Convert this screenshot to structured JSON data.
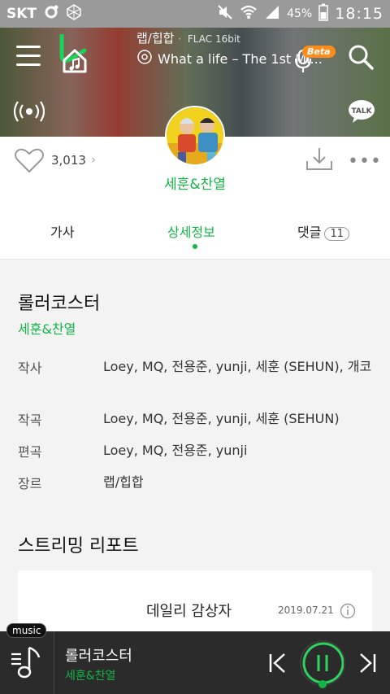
{
  "status": {
    "carrier": "SKT",
    "battery": "45%",
    "time": "18:15"
  },
  "header": {
    "genre": "랩/힙합",
    "quality": "FLAC 16bit",
    "now_playing": "What a life – The 1st Mi...",
    "beta_badge": "Beta",
    "talk_label": "TALK"
  },
  "song": {
    "artist": "세훈&찬열",
    "likes": "3,013",
    "title": "롤러코스터"
  },
  "tabs": [
    {
      "label": "가사",
      "active": false
    },
    {
      "label": "상세정보",
      "active": true
    },
    {
      "label": "댓글",
      "count": "11",
      "active": false
    }
  ],
  "details": [
    {
      "label": "작사",
      "value": "Loey, MQ, 전용준, yunji, 세훈 (SEHUN), 개코"
    },
    {
      "label": "작곡",
      "value": "Loey, MQ, 전용준, yunji, 세훈 (SEHUN)"
    },
    {
      "label": "편곡",
      "value": "Loey, MQ, 전용준, yunji"
    },
    {
      "label": "장르",
      "value": "랩/힙합"
    }
  ],
  "report": {
    "title": "스트리밍 리포트",
    "card_title": "데일리 감상자",
    "date": "2019.07.21"
  },
  "player": {
    "badge": "music",
    "title": "롤러코스터",
    "artist": "세훈&찬열"
  },
  "colors": {
    "accent": "#13b547",
    "player_bg": "#2b2b2b",
    "beta": "#ff8c1a"
  }
}
